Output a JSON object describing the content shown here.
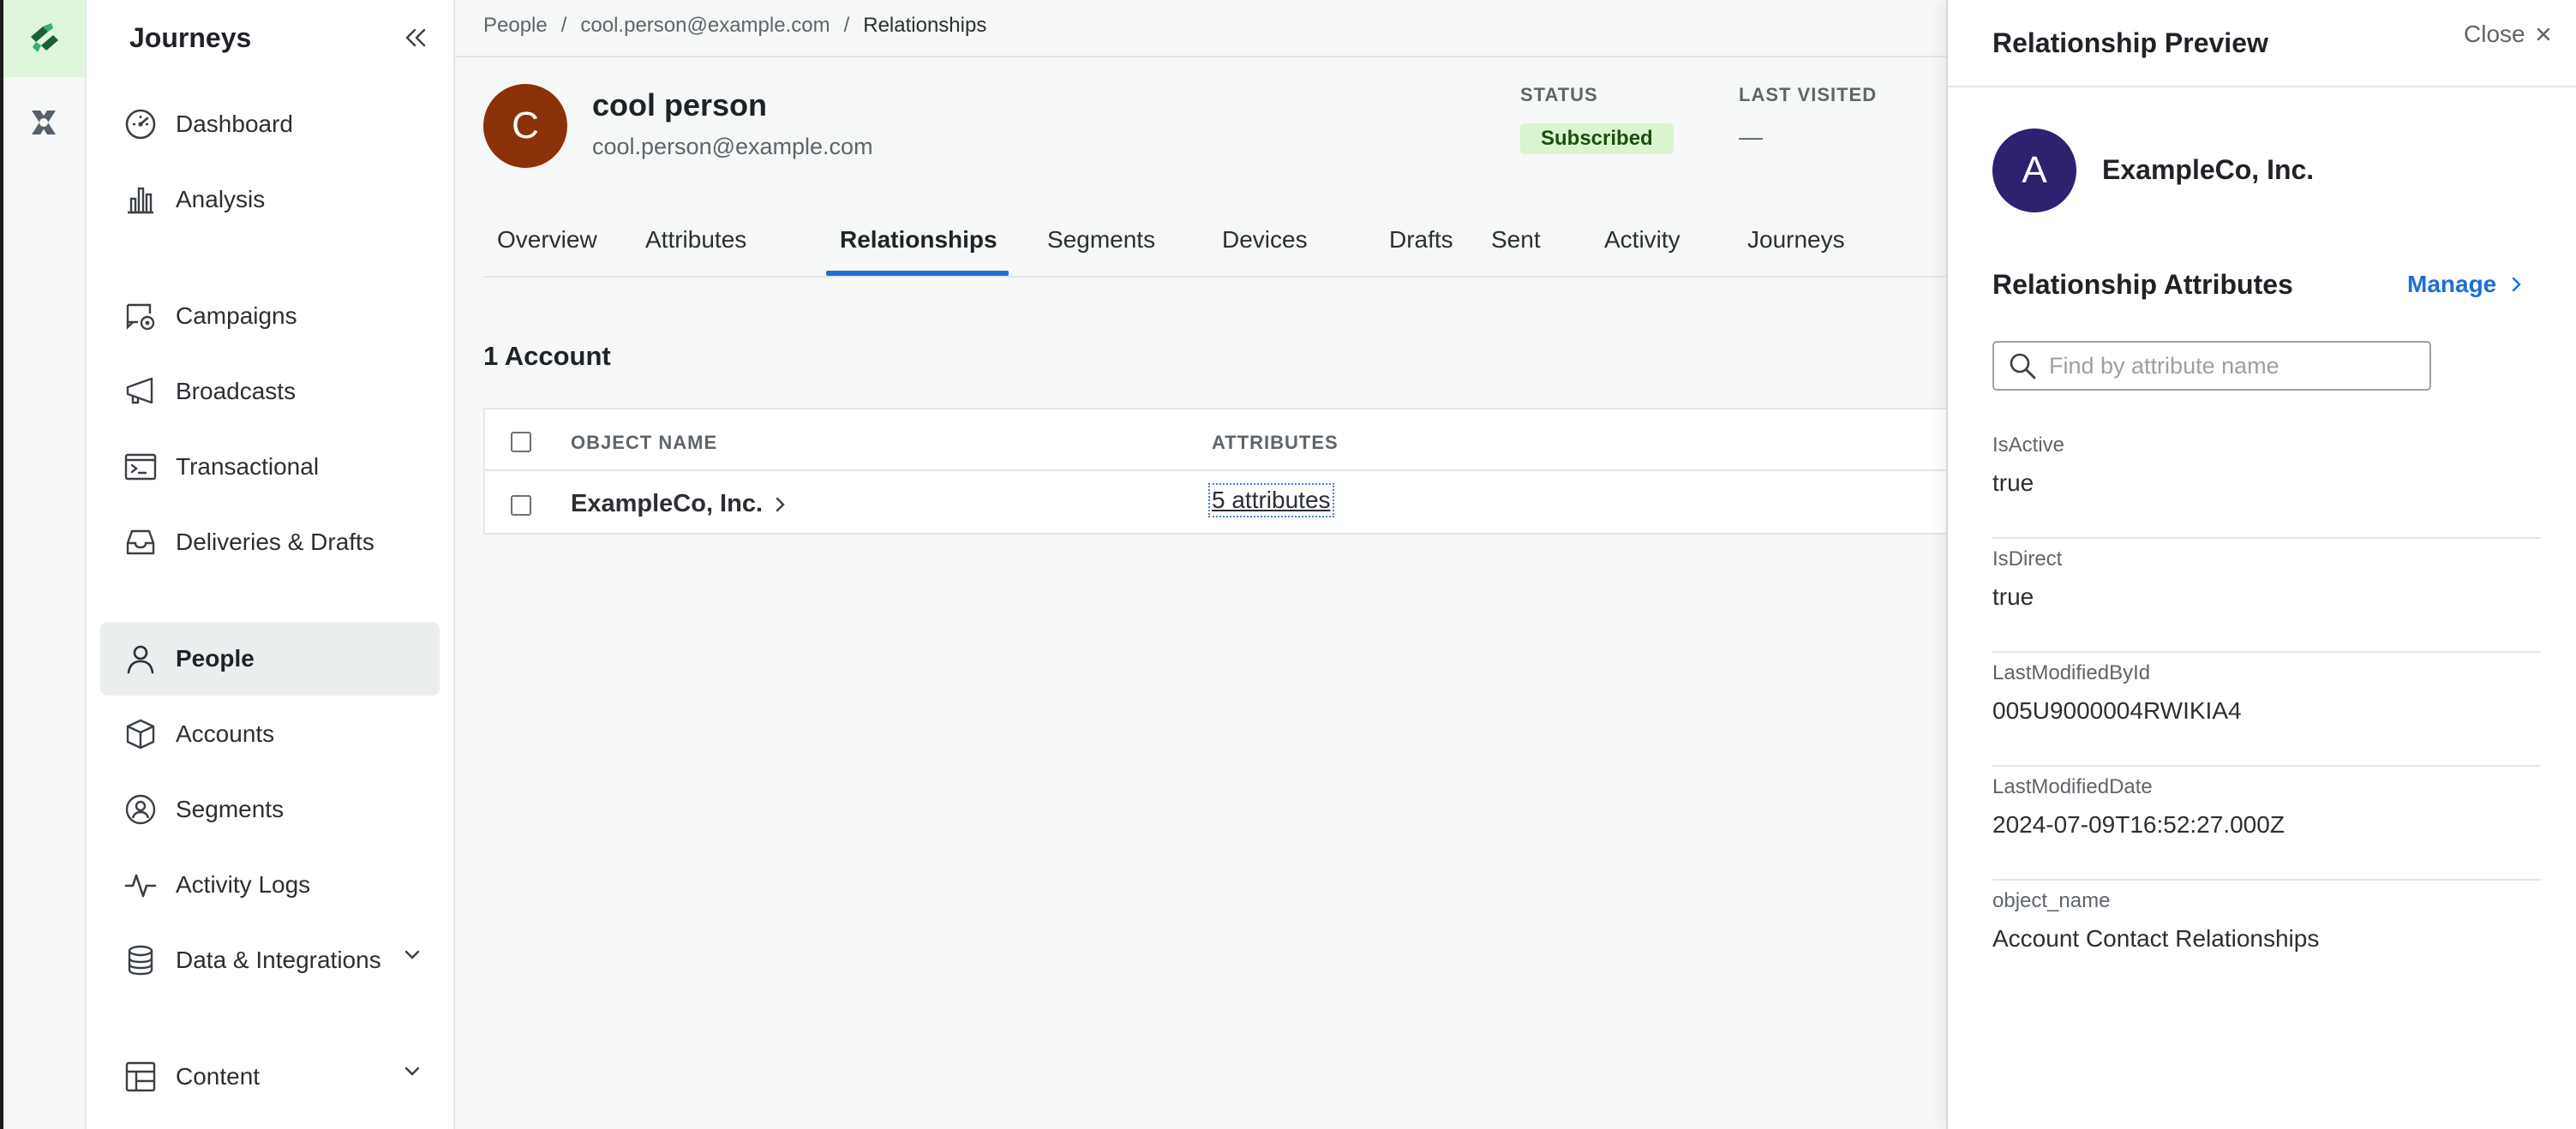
{
  "sidebar": {
    "title": "Journeys",
    "items": [
      {
        "label": "Dashboard",
        "icon": "gauge-icon"
      },
      {
        "label": "Analysis",
        "icon": "bar-chart-icon"
      },
      {
        "label": "Campaigns",
        "icon": "campaign-icon"
      },
      {
        "label": "Broadcasts",
        "icon": "megaphone-icon"
      },
      {
        "label": "Transactional",
        "icon": "terminal-icon"
      },
      {
        "label": "Deliveries & Drafts",
        "icon": "inbox-icon"
      },
      {
        "label": "People",
        "icon": "person-icon",
        "active": true
      },
      {
        "label": "Accounts",
        "icon": "cube-icon"
      },
      {
        "label": "Segments",
        "icon": "segment-icon"
      },
      {
        "label": "Activity Logs",
        "icon": "pulse-icon"
      },
      {
        "label": "Data & Integrations",
        "icon": "database-icon"
      },
      {
        "label": "Content",
        "icon": "layout-icon"
      }
    ]
  },
  "breadcrumb": {
    "items": [
      "People",
      "cool.person@example.com",
      "Relationships"
    ],
    "separator": "/"
  },
  "person": {
    "initial": "C",
    "name": "cool person",
    "email": "cool.person@example.com",
    "status_label": "STATUS",
    "status_value": "Subscribed",
    "last_visited_label": "LAST VISITED",
    "last_visited_value": "—"
  },
  "tabs": [
    "Overview",
    "Attributes",
    "Relationships",
    "Segments",
    "Devices",
    "Drafts",
    "Sent",
    "Activity",
    "Journeys"
  ],
  "active_tab": "Relationships",
  "accounts": {
    "heading": "1 Account",
    "columns": [
      "OBJECT NAME",
      "ATTRIBUTES"
    ],
    "rows": [
      {
        "name": "ExampleCo, Inc.",
        "attributes": "5 attributes"
      }
    ]
  },
  "panel": {
    "title": "Relationship Preview",
    "close_label": "Close",
    "account_initial": "A",
    "account_name": "ExampleCo, Inc.",
    "attributes_title": "Relationship Attributes",
    "manage_label": "Manage",
    "search_placeholder": "Find by attribute name",
    "attributes": [
      {
        "key": "IsActive",
        "value": "true"
      },
      {
        "key": "IsDirect",
        "value": "true"
      },
      {
        "key": "LastModifiedById",
        "value": "005U9000004RWIKIA4"
      },
      {
        "key": "LastModifiedDate",
        "value": "2024-07-09T16:52:27.000Z"
      },
      {
        "key": "object_name",
        "value": "Account Contact Relationships"
      }
    ]
  },
  "colors": {
    "accent": "#1d6fd8",
    "person_avatar": "#8b3109",
    "account_avatar": "#2d2170",
    "status_badge_bg": "#d9f5cf",
    "logo_bg": "#dff5dc"
  }
}
